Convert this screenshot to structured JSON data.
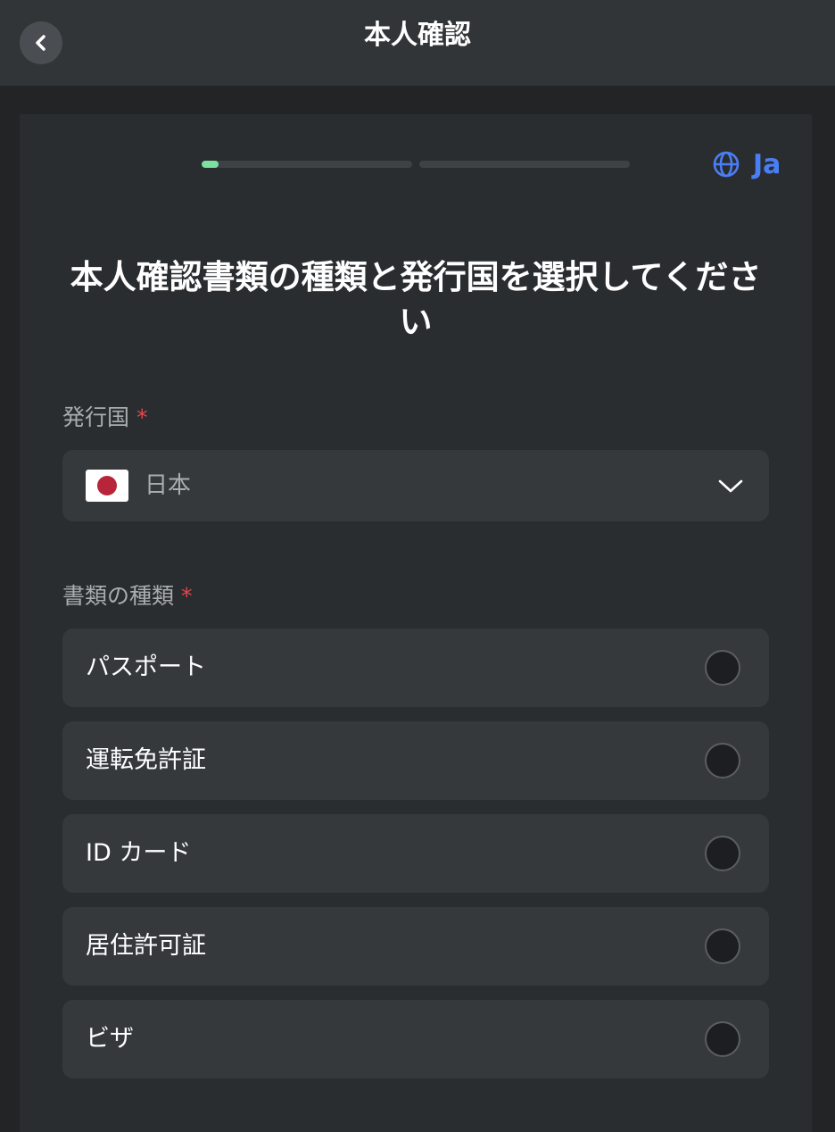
{
  "header": {
    "title": "本人確認",
    "back_icon": "chevron-left-icon"
  },
  "progress": {
    "step1_fraction": 0.08,
    "step2_fraction": 0.0,
    "accent_color": "#7ee0a0"
  },
  "language": {
    "icon": "globe-icon",
    "label": "Ja",
    "color": "#4a7ef5"
  },
  "main": {
    "heading": "本人確認書類の種類と発行国を選択してください"
  },
  "country_field": {
    "label": "発行国",
    "required_mark": "*",
    "value": "日本",
    "flag_icon": "japan-flag-icon",
    "dropdown_icon": "chevron-down-icon"
  },
  "document_field": {
    "label": "書類の種類",
    "required_mark": "*",
    "options": [
      {
        "label": "パスポート",
        "selected": false
      },
      {
        "label": "運転免許証",
        "selected": false
      },
      {
        "label": "ID カード",
        "selected": false
      },
      {
        "label": "居住許可証",
        "selected": false
      },
      {
        "label": "ビザ",
        "selected": false
      }
    ]
  }
}
